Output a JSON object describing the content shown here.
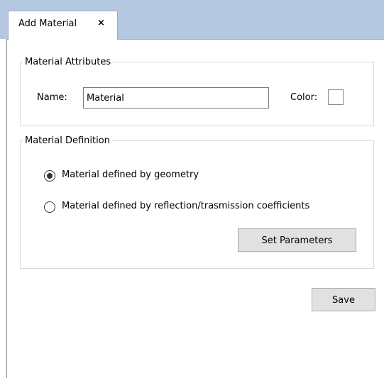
{
  "tab": {
    "label": "Add Material",
    "close_glyph": "×"
  },
  "attributes": {
    "legend": "Material Attributes",
    "name_label": "Name:",
    "name_value": "Material",
    "color_label": "Color:"
  },
  "definition": {
    "legend": "Material Definition",
    "options": [
      {
        "label": "Material defined by geometry",
        "selected": true
      },
      {
        "label": "Material defined by reflection/trasmission coefficients",
        "selected": false
      }
    ],
    "set_parameters_label": "Set Parameters"
  },
  "actions": {
    "save_label": "Save"
  },
  "colors": {
    "tabbar_bg": "#b4c8e1",
    "button_bg": "#e1e1e1",
    "group_border": "#d9d9d9"
  }
}
